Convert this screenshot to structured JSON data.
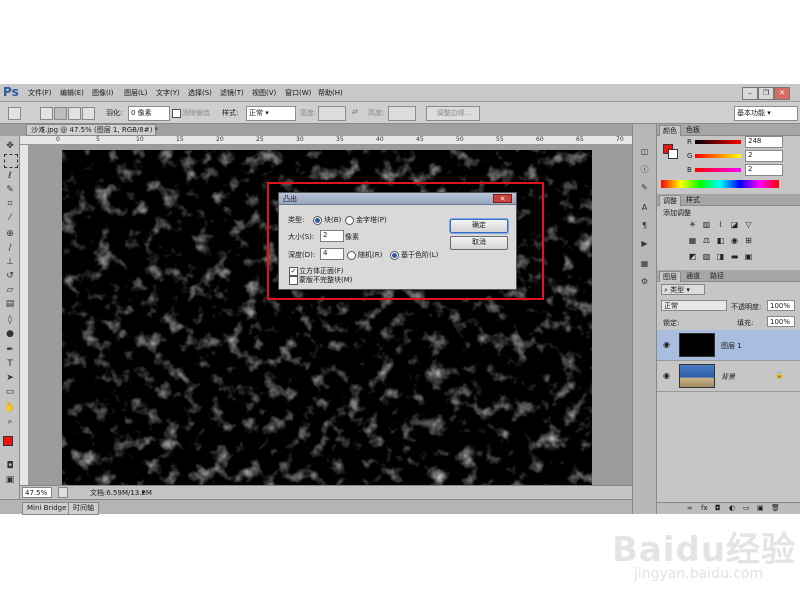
{
  "app": {
    "logo": "Ps"
  },
  "menu": [
    "文件(F)",
    "编辑(E)",
    "图像(I)",
    "图层(L)",
    "文字(Y)",
    "选择(S)",
    "滤镜(T)",
    "视图(V)",
    "窗口(W)",
    "帮助(H)"
  ],
  "options": {
    "feather_label": "羽化:",
    "feather_value": "0 像素",
    "antialias": "消除锯齿",
    "style_label": "样式:",
    "style_value": "正常",
    "width_label": "宽度:",
    "height_label": "高度:",
    "refine_edge": "调整边缘...",
    "workspace": "基本功能"
  },
  "document": {
    "tab_label": "沙滩.jpg @ 47.5% (图层 1, RGB/8#) *",
    "ruler_top": [
      "0",
      "5",
      "10",
      "15",
      "20",
      "25",
      "30",
      "35",
      "40",
      "45",
      "50",
      "55",
      "60",
      "65",
      "70"
    ],
    "zoom": "47.5%",
    "doc_size": "文档:6.59M/13.2M"
  },
  "bottom_tabs": [
    "Mini Bridge",
    "时间轴"
  ],
  "color_panel": {
    "tabs": [
      "颜色",
      "色板"
    ],
    "r_label": "R",
    "r_value": "248",
    "g_label": "G",
    "g_value": "2",
    "b_label": "B",
    "b_value": "2",
    "foreground": "#ee1111",
    "background": "#ffffff"
  },
  "adjust_panel": {
    "tabs": [
      "调整",
      "样式"
    ],
    "title": "添加调整"
  },
  "layers_panel": {
    "tabs": [
      "图层",
      "通道",
      "路径"
    ],
    "filter_kind": "类型",
    "blend_mode": "正常",
    "opacity_label": "不透明度:",
    "opacity_value": "100%",
    "lock_label": "锁定:",
    "fill_label": "填充:",
    "fill_value": "100%",
    "layers": [
      {
        "name": "图层 1",
        "selected": true
      },
      {
        "name": "背景",
        "selected": false
      }
    ]
  },
  "dialog": {
    "title": "凸出",
    "type_label": "类型:",
    "type_block": "块(B)",
    "type_pyramid": "金字塔(P)",
    "size_label": "大小(S):",
    "size_value": "2",
    "size_unit": "像素",
    "depth_label": "深度(D):",
    "depth_value": "4",
    "random": "随机(R)",
    "level_based": "基于色阶(L)",
    "solid_front": "立方体正面(F)",
    "mask_incomplete": "蒙版不完整块(M)",
    "ok": "确定",
    "cancel": "取消"
  },
  "watermark": {
    "brand": "Baidu经验",
    "url": "jingyan.baidu.com"
  }
}
